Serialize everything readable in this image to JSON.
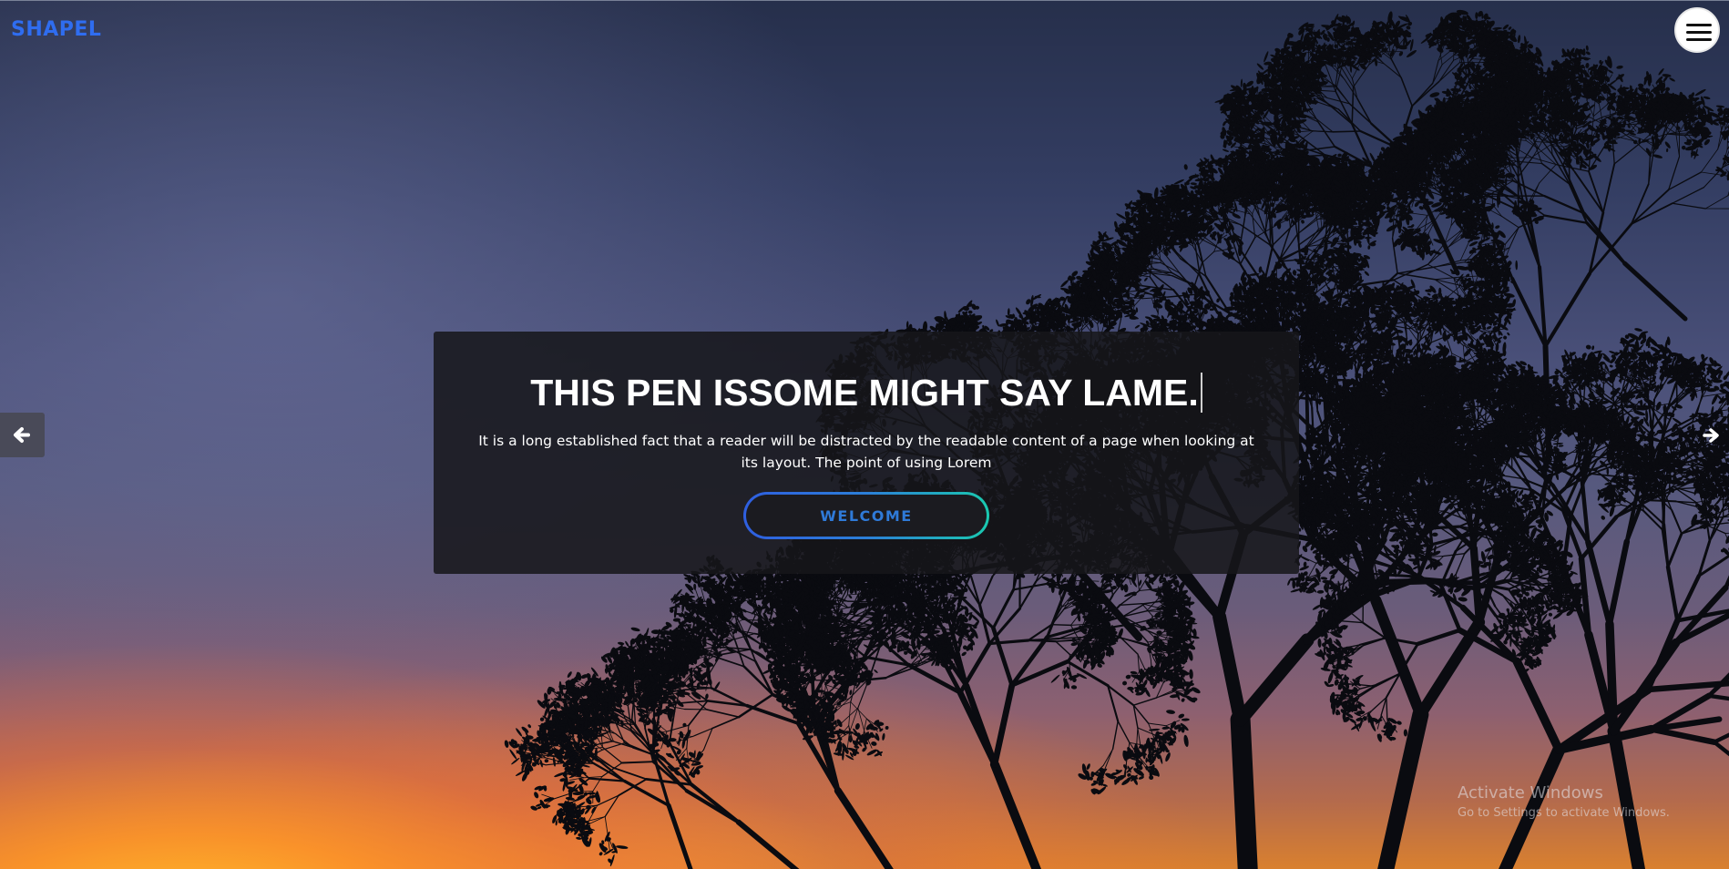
{
  "brand": {
    "logo_text": "SHAPEL",
    "color": "#2f6df0"
  },
  "header": {
    "menu_icon": "hamburger-menu-icon"
  },
  "slider": {
    "prev_icon": "arrow-left-icon",
    "next_icon": "arrow-right-icon"
  },
  "hero": {
    "title": "THIS PEN ISSOME MIGHT SAY LAME.",
    "description": "It is a long established fact that a reader will be distracted by the readable content of a page when looking at its layout. The point of using Lorem",
    "button_label": "WELCOME",
    "button_gradient": [
      "#2f5fe0",
      "#1ac9b0"
    ]
  },
  "watermark": {
    "line1": "Activate Windows",
    "line2": "Go to Settings to activate Windows."
  }
}
